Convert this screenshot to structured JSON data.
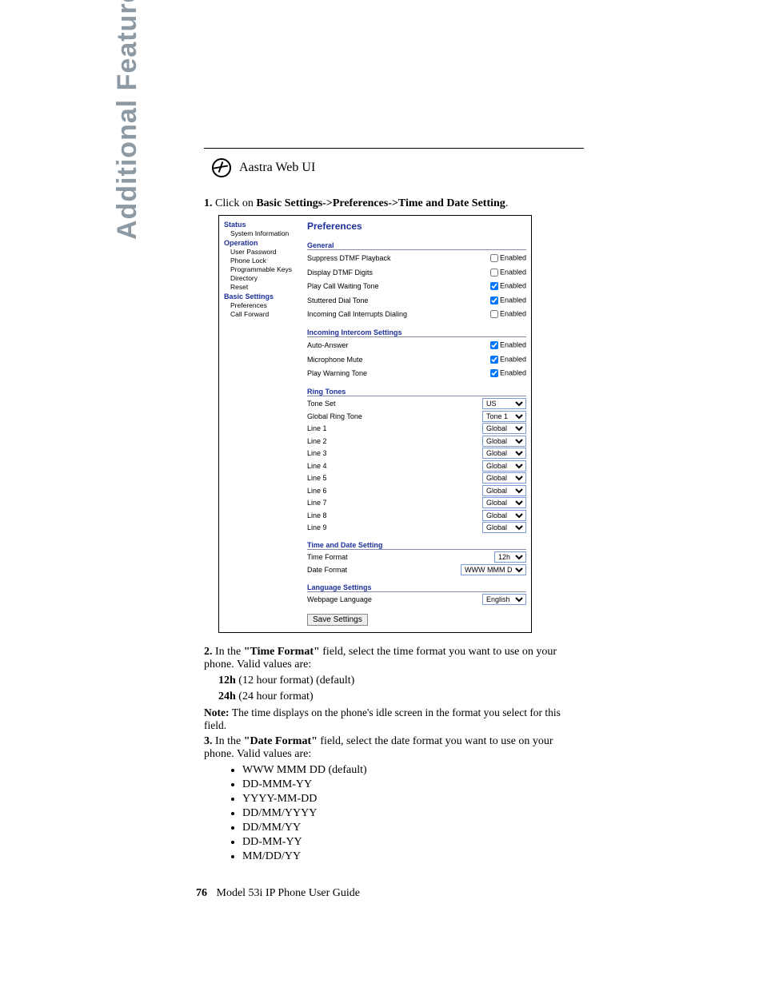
{
  "side_title": "Additional Features",
  "webui_label": "Aastra Web UI",
  "step1": {
    "num": "1.",
    "prefix": "Click on ",
    "bold": "Basic Settings->Preferences->Time and Date Setting",
    "suffix": "."
  },
  "sidenav": {
    "status": "Status",
    "sysinfo": "System Information",
    "operation": "Operation",
    "userpw": "User Password",
    "phonelock": "Phone Lock",
    "progkeys": "Programmable Keys",
    "directory": "Directory",
    "reset": "Reset",
    "basic": "Basic Settings",
    "prefs": "Preferences",
    "callfwd": "Call Forward"
  },
  "panel": {
    "title": "Preferences",
    "general_hdr": "General",
    "general": [
      {
        "label": "Suppress DTMF Playback",
        "checked": false
      },
      {
        "label": "Display DTMF Digits",
        "checked": false
      },
      {
        "label": "Play Call Waiting Tone",
        "checked": true
      },
      {
        "label": "Stuttered Dial Tone",
        "checked": true
      },
      {
        "label": "Incoming Call Interrupts Dialing",
        "checked": false
      }
    ],
    "intercom_hdr": "Incoming Intercom Settings",
    "intercom": [
      {
        "label": "Auto-Answer",
        "checked": true
      },
      {
        "label": "Microphone Mute",
        "checked": true
      },
      {
        "label": "Play Warning Tone",
        "checked": true
      }
    ],
    "ring_hdr": "Ring Tones",
    "ring": {
      "toneset_label": "Tone Set",
      "toneset_value": "US",
      "global_label": "Global Ring Tone",
      "global_value": "Tone 1",
      "lines": [
        "Line 1",
        "Line 2",
        "Line 3",
        "Line 4",
        "Line 5",
        "Line 6",
        "Line 7",
        "Line 8",
        "Line 9"
      ],
      "line_value": "Global"
    },
    "td_hdr": "Time and Date Setting",
    "timeformat_label": "Time Format",
    "timeformat_value": "12h",
    "dateformat_label": "Date Format",
    "dateformat_value": "WWW MMM DD",
    "lang_hdr": "Language Settings",
    "lang_label": "Webpage Language",
    "lang_value": "English",
    "save_btn": "Save Settings",
    "enabled_text": "Enabled"
  },
  "step2": {
    "num": "2.",
    "text_a": "In the ",
    "bold_a": "\"Time Format\"",
    "text_b": " field, select the time format you want to use on your phone. Valid values are:",
    "opt1b": "12h",
    "opt1t": " (12 hour format) (default)",
    "opt2b": "24h",
    "opt2t": " (24 hour format)"
  },
  "note": {
    "b": "Note: ",
    "t": "The time displays on the phone's idle screen in the format you select for this field."
  },
  "step3": {
    "num": "3.",
    "text_a": "In the ",
    "bold_a": "\"Date Format\"",
    "text_b": " field, select the date format you want to use on your phone. Valid values are:",
    "options": [
      "WWW MMM DD (default)",
      "DD-MMM-YY",
      "YYYY-MM-DD",
      "DD/MM/YYYY",
      "DD/MM/YY",
      "DD-MM-YY",
      "MM/DD/YY"
    ]
  },
  "footer": {
    "page": "76",
    "title": "Model 53i IP Phone User Guide"
  }
}
